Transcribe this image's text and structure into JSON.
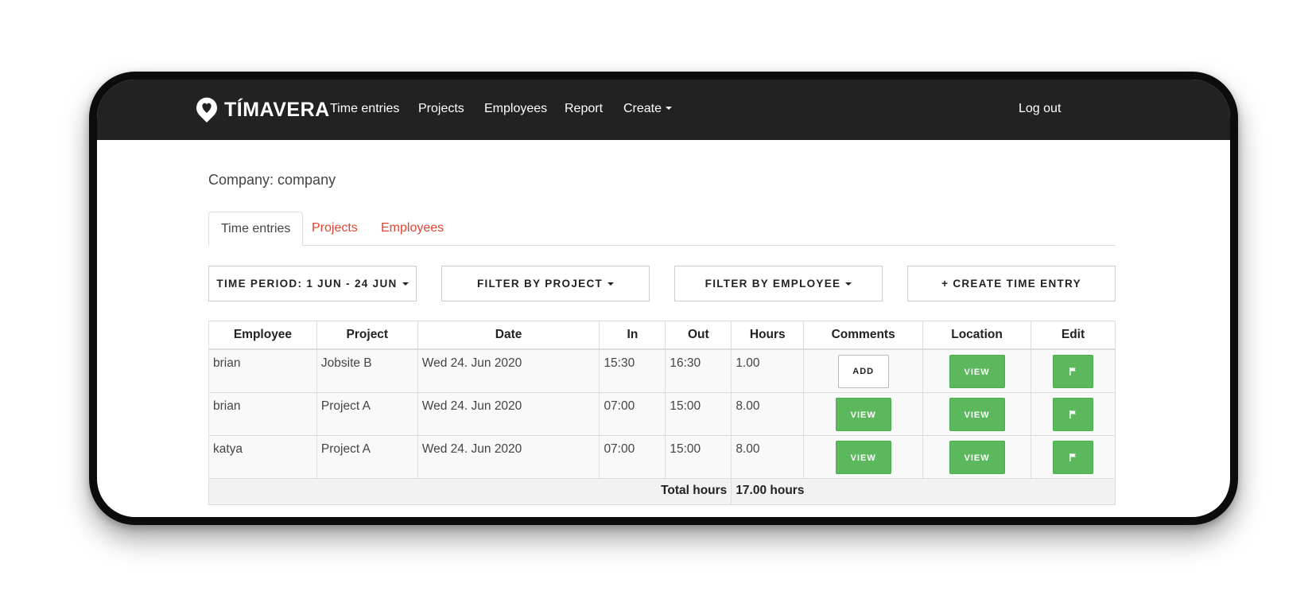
{
  "nav": {
    "brand": "TÍMAVERA",
    "links": [
      "Time entries",
      "Projects",
      "Employees",
      "Report",
      "Create"
    ],
    "logout": "Log out"
  },
  "page": {
    "company": "Company: company",
    "tabs": [
      "Time entries",
      "Projects",
      "Employees"
    ],
    "active_tab": "Time entries"
  },
  "filters": {
    "time_period": "TIME PERIOD: 1 JUN - 24 JUN",
    "project": "FILTER BY PROJECT",
    "employee": "FILTER BY EMPLOYEE",
    "create": "+ CREATE TIME ENTRY"
  },
  "table": {
    "headers": [
      "Employee",
      "Project",
      "Date",
      "In",
      "Out",
      "Hours",
      "Comments",
      "Location",
      "Edit"
    ],
    "rows": [
      {
        "employee": "brian",
        "project": "Jobsite B",
        "date": "Wed 24. Jun 2020",
        "in": "15:30",
        "out": "16:30",
        "hours": "1.00",
        "comments": "ADD",
        "location": "VIEW",
        "edit_icon": "flag-icon"
      },
      {
        "employee": "brian",
        "project": "Project A",
        "date": "Wed 24. Jun 2020",
        "in": "07:00",
        "out": "15:00",
        "hours": "8.00",
        "comments": "VIEW",
        "location": "VIEW",
        "edit_icon": "flag-icon"
      },
      {
        "employee": "katya",
        "project": "Project A",
        "date": "Wed 24. Jun 2020",
        "in": "07:00",
        "out": "15:00",
        "hours": "8.00",
        "comments": "VIEW",
        "location": "VIEW",
        "edit_icon": "flag-icon"
      }
    ],
    "total_label": "Total hours",
    "total_value": "17.00 hours"
  },
  "colors": {
    "navbar": "#222222",
    "accent_link": "#e2432f",
    "success": "#5cb85c"
  }
}
